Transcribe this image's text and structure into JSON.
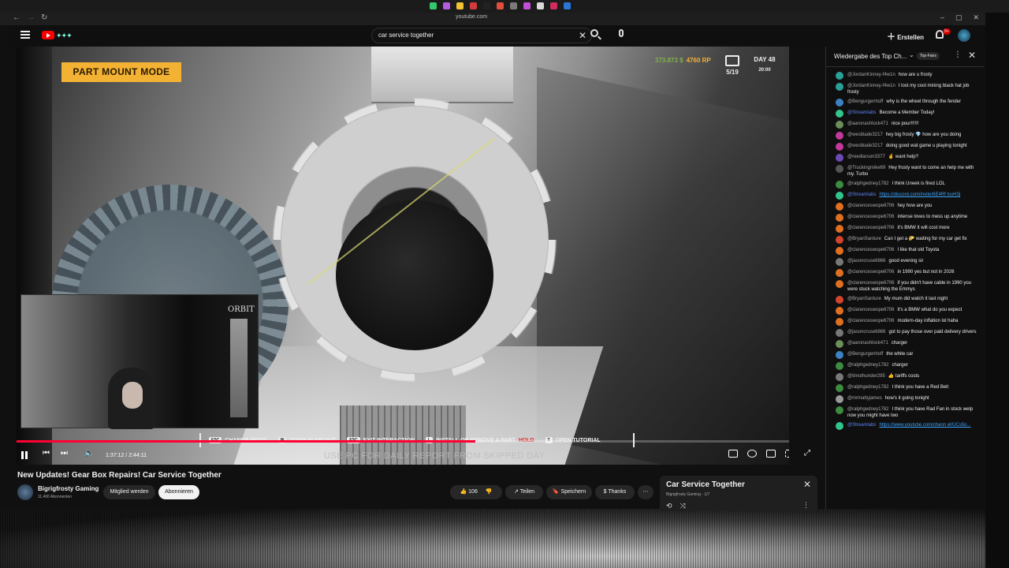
{
  "browser": {
    "url": "youtube.com",
    "extension_colors": [
      "#33c86b",
      "#b35ce0",
      "#f3c233",
      "#d23b3b",
      "#222222",
      "#e34d3b",
      "#7a7a7a",
      "#c24dd6",
      "#d9d9d9",
      "#d22c5c",
      "#2a76d6"
    ]
  },
  "header": {
    "search_value": "car service together",
    "create_label": "Erstellen",
    "bell_badge": "9+"
  },
  "video": {
    "hud": {
      "mode_label": "PART MOUNT MODE",
      "money": "373.873 $",
      "rp": "4760 RP",
      "jobs": "5/19",
      "day": "DAY 48",
      "time": "20:00"
    },
    "webcam_logo": "ORBIT",
    "hints": [
      {
        "key": "ESC",
        "label": "CHANGE MODE"
      },
      {
        "key": "W",
        "label": "ZOOM IN OR OUT"
      },
      {
        "key": "ESC",
        "label": "EXIT INTERACTION"
      },
      {
        "key": "L",
        "label": "INSTALL OR REMOVE A PART"
      },
      {
        "key": "T",
        "label": "OPEN TUTORIAL"
      }
    ],
    "hint_hold": "HOLD",
    "subtitle": "USE PC FOR DAILY REPORT FROM SKIPPED DAY",
    "time_display": "1:37:12 / 2:44:11",
    "progress_fraction": 0.594,
    "progress_color": "#ff0033"
  },
  "title_area": {
    "title": "New Updates! Gear Box Repairs! Car Service Together",
    "channel_name": "Bigrigfrosty Gaming",
    "subscribers": "11.400 Abonnenten",
    "member_label": "Mitglied werden",
    "subscribe_label": "Abonnieren",
    "like_count": "106",
    "share_label": "Teilen",
    "save_label": "Speichern",
    "thanks_label": "Thanks"
  },
  "playlist": {
    "title": "Car Service Together",
    "sub": "Bigrigfrosty Gaming - 1/7"
  },
  "chat": {
    "title": "Wiedergabe des Top Ch...",
    "topfans": "Top-Fans",
    "messages": [
      {
        "author": "@JordanKinney-f4w1n",
        "text": "how are u frosty",
        "color": "#2aa198",
        "mod": false,
        "link": false
      },
      {
        "author": "@JordanKinney-f4w1n",
        "text": "I lost my cool mining black hat job frosty",
        "color": "#2aa198",
        "mod": false,
        "link": false
      },
      {
        "author": "@Bengurgenhoff",
        "text": "why is the wheel through the fender",
        "color": "#3b82c4",
        "mod": false,
        "link": false
      },
      {
        "author": "@Streamlabs",
        "text": "Become a Member Today!",
        "color": "#31c48d",
        "mod": true,
        "link": false
      },
      {
        "author": "@aaronashlock471",
        "text": "nice pour!!!!!!",
        "color": "#6b8e5a",
        "mod": false,
        "link": false
      },
      {
        "author": "@wesblade3217",
        "text": "hey big frosty 💎 how are you doing",
        "color": "#c2389b",
        "mod": false,
        "link": false
      },
      {
        "author": "@wesblade3217",
        "text": "doing good wat game u playing tonight",
        "color": "#c2389b",
        "mod": false,
        "link": false
      },
      {
        "author": "@reedlarson3377",
        "text": "🤞 want help?",
        "color": "#6c4ab6",
        "mod": false,
        "link": false
      },
      {
        "author": "@Truckingmike69",
        "text": "Hey frosty want to come an help me with my. Turbo",
        "color": "#555555",
        "mod": false,
        "link": false
      },
      {
        "author": "@ralphgedney1782",
        "text": "I think Uneek is fired LOL",
        "color": "#3d8b40",
        "mod": false,
        "link": false
      },
      {
        "author": "@Streamlabs",
        "text": "https://discord.com/invite/6E4Rf tsxH3j",
        "color": "#31c48d",
        "mod": true,
        "link": true
      },
      {
        "author": "@clarenceswope6706",
        "text": "hey how are you",
        "color": "#e07020",
        "mod": false,
        "link": false
      },
      {
        "author": "@clarenceswope6706",
        "text": "intense loves to mess up anytime",
        "color": "#e07020",
        "mod": false,
        "link": false
      },
      {
        "author": "@clarenceswope6706",
        "text": "it's BMW it will cost more",
        "color": "#e07020",
        "mod": false,
        "link": false
      },
      {
        "author": "@BryanSanture",
        "text": "Can I get a 🌮 waiting for my car get fix",
        "color": "#d0452b",
        "mod": false,
        "link": false
      },
      {
        "author": "@clarenceswope6706",
        "text": "I like that old Toyota",
        "color": "#e07020",
        "mod": false,
        "link": false
      },
      {
        "author": "@jasoncruse6866",
        "text": "good evening sir",
        "color": "#777777",
        "mod": false,
        "link": false
      },
      {
        "author": "@clarenceswope6706",
        "text": "in 1990 yes but not in 2026",
        "color": "#e07020",
        "mod": false,
        "link": false
      },
      {
        "author": "@clarenceswope6706",
        "text": "if you didn't have cable in 1990 you were stuck watching the Emmys",
        "color": "#e07020",
        "mod": false,
        "link": false
      },
      {
        "author": "@BryanSanture",
        "text": "My mum did watch it last night",
        "color": "#d0452b",
        "mod": false,
        "link": false
      },
      {
        "author": "@clarenceswope6706",
        "text": "it's a BMW what do you expect",
        "color": "#e07020",
        "mod": false,
        "link": false
      },
      {
        "author": "@clarenceswope6706",
        "text": "modern-day inflation lol haha",
        "color": "#e07020",
        "mod": false,
        "link": false
      },
      {
        "author": "@jasoncruse6866",
        "text": "got to pay those over paid delivery drivers",
        "color": "#777777",
        "mod": false,
        "link": false
      },
      {
        "author": "@aaronashlock471",
        "text": "charger",
        "color": "#6b8e5a",
        "mod": false,
        "link": false
      },
      {
        "author": "@Bengurgenhoff",
        "text": "the white car",
        "color": "#3b82c4",
        "mod": false,
        "link": false
      },
      {
        "author": "@ralphgedney1782",
        "text": "charger",
        "color": "#3d8b40",
        "mod": false,
        "link": false
      },
      {
        "author": "@timothunder295",
        "text": "👍 tariffs costs",
        "color": "#7a7a7a",
        "mod": false,
        "link": false
      },
      {
        "author": "@ralphgedney1782",
        "text": "I think you have a Red Belt",
        "color": "#3d8b40",
        "mod": false,
        "link": false
      },
      {
        "author": "@mrmattyjames",
        "text": "how's it going tonight",
        "color": "#999999",
        "mod": false,
        "link": false
      },
      {
        "author": "@ralphgedney1782",
        "text": "I think you have Rad Fan in stock welp now you might have two",
        "color": "#3d8b40",
        "mod": false,
        "link": false
      },
      {
        "author": "@Streamlabs",
        "text": "https://www.youtube.com/chann el/UCs5o...",
        "color": "#31c48d",
        "mod": true,
        "link": true
      }
    ]
  }
}
